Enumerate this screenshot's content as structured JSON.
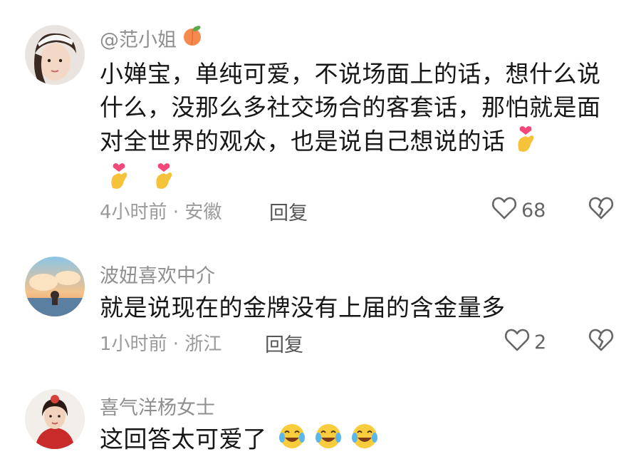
{
  "comments": [
    {
      "username": "@范小姐",
      "username_emoji": "peach-emoji",
      "text": "小婵宝，单纯可爱，不说场面上的话，想什么说什么，没那么多社交场合的客套话，那怕就是面对全世界的观众，也是说自己想说的话",
      "trailing_emoji": "finger-heart-emoji",
      "emoji_count_after_text": 3,
      "meta": "4小时前 · 安徽",
      "reply_label": "回复",
      "likes": "68"
    },
    {
      "username": "波妞喜欢中介",
      "text": "就是说现在的金牌没有上届的含金量多",
      "meta": "1小时前 · 浙江",
      "reply_label": "回复",
      "likes": "2"
    },
    {
      "username": "喜气洋杨女士",
      "text": "这回答太可爱了",
      "trailing_emoji": "laughing-tears-emoji",
      "emoji_count_after_text": 3
    }
  ],
  "colors": {
    "username": "#8f8f8f",
    "body_text": "#161616",
    "meta": "#9a9a9a",
    "reply": "#555555",
    "icon": "#666666"
  }
}
